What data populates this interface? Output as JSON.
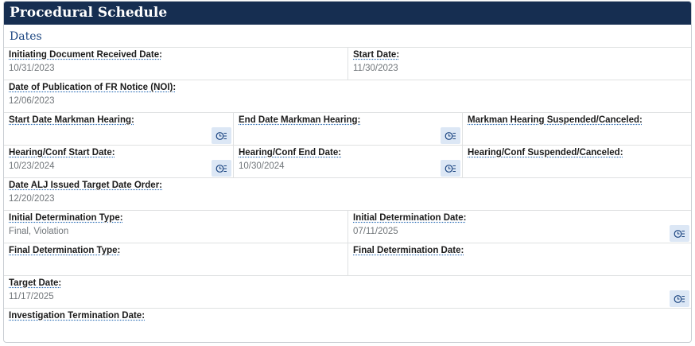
{
  "panel": {
    "title": "Procedural Schedule"
  },
  "section": {
    "title": "Dates"
  },
  "rows": {
    "r1": {
      "c1": {
        "label": "Initiating Document Received Date:",
        "value": "10/31/2023"
      },
      "c2": {
        "label": "Start Date:",
        "value": "11/30/2023"
      }
    },
    "r2": {
      "c1": {
        "label": "Date of Publication of FR Notice (NOI):",
        "value": "12/06/2023"
      }
    },
    "r3": {
      "c1": {
        "label": "Start Date Markman Hearing:",
        "value": ""
      },
      "c2": {
        "label": "End Date Markman Hearing:",
        "value": ""
      },
      "c3": {
        "label": "Markman Hearing Suspended/Canceled:",
        "value": ""
      }
    },
    "r4": {
      "c1": {
        "label": "Hearing/Conf Start Date:",
        "value": "10/23/2024"
      },
      "c2": {
        "label": "Hearing/Conf End Date:",
        "value": "10/30/2024"
      },
      "c3": {
        "label": "Hearing/Conf Suspended/Canceled:",
        "value": ""
      }
    },
    "r5": {
      "c1": {
        "label": "Date ALJ Issued Target Date Order:",
        "value": "12/20/2023"
      }
    },
    "r6": {
      "c1": {
        "label": "Initial Determination Type:",
        "value": "Final, Violation"
      },
      "c2": {
        "label": "Initial Determination Date:",
        "value": "07/11/2025"
      }
    },
    "r7": {
      "c1": {
        "label": "Final Determination Type:",
        "value": ""
      },
      "c2": {
        "label": "Final Determination Date:",
        "value": ""
      }
    },
    "r8": {
      "c1": {
        "label": "Target Date:",
        "value": "11/17/2025"
      }
    },
    "r9": {
      "c1": {
        "label": "Investigation Termination Date:",
        "value": ""
      }
    }
  },
  "icons": {
    "history": "history-list-icon"
  },
  "colors": {
    "header_bg": "#162e51",
    "section_title": "#1a4480",
    "icon_bg": "#dce7f5"
  }
}
